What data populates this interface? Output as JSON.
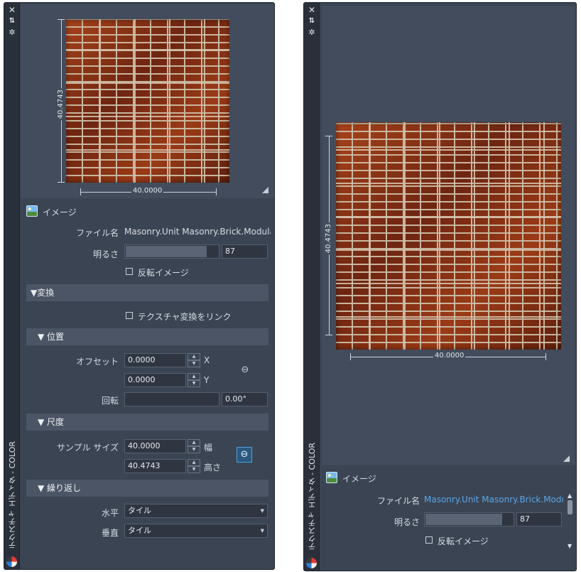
{
  "palette_title": "テクスチャ エディタ - COLOR",
  "titlebar_icons": {
    "close": "close-icon",
    "pin": "auto-hide-icon",
    "settings": "gear-icon"
  },
  "preview": {
    "width_value": "40.0000",
    "height_value": "40.4743"
  },
  "image_section": {
    "heading": "イメージ",
    "filename_label": "ファイル名",
    "filename_value": "Masonry.Unit Masonry.Brick.Modular.B",
    "filename_value_right": "Masonry.Unit Masonry.Brick.Modular",
    "brightness_label": "明るさ",
    "brightness_value": "87",
    "brightness_fill": 0.87,
    "invert_label": "反転イメージ",
    "invert_checked": false
  },
  "transform_section": {
    "heading": "▼変換",
    "link_label": "テクスチャ変換をリンク",
    "link_checked": false
  },
  "position_section": {
    "heading": "▼ 位置",
    "offset_label": "オフセット",
    "offset_x": "0.0000",
    "offset_y": "0.0000",
    "x_label": "X",
    "y_label": "Y",
    "rotation_label": "回転",
    "rotation_value": "0.00°"
  },
  "scale_section": {
    "heading": "▼ 尺度",
    "sample_size_label": "サンプル サイズ",
    "width_value": "40.0000",
    "height_value": "40.4743",
    "width_label": "幅",
    "height_label": "高さ"
  },
  "repeat_section": {
    "heading": "▼ 繰り返し",
    "horizontal_label": "水平",
    "horizontal_value": "タイル",
    "vertical_label": "垂直",
    "vertical_value": "タイル"
  }
}
